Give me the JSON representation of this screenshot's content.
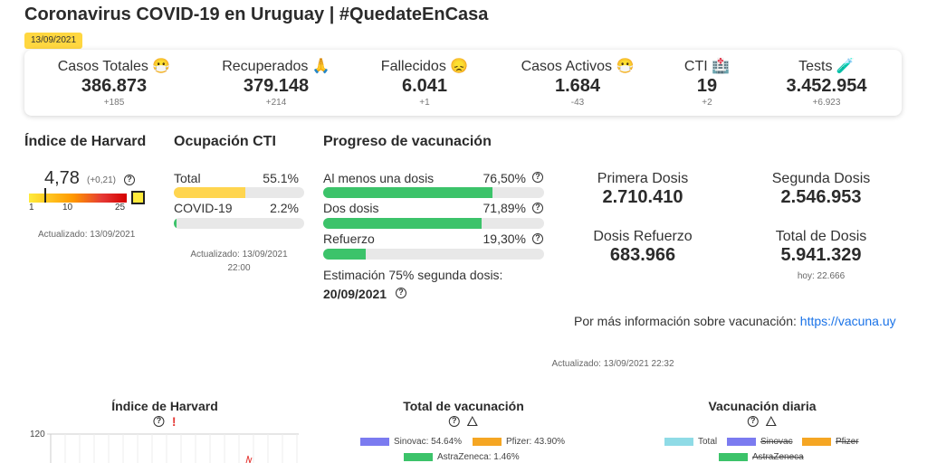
{
  "header": {
    "title": "Coronavirus COVID-19 en Uruguay | #QuedateEnCasa",
    "date": "13/09/2021"
  },
  "stats": [
    {
      "label": "Casos Totales 😷",
      "value": "386.873",
      "delta": "+185"
    },
    {
      "label": "Recuperados 🙏",
      "value": "379.148",
      "delta": "+214"
    },
    {
      "label": "Fallecidos 😞",
      "value": "6.041",
      "delta": "+1"
    },
    {
      "label": "Casos Activos 😷",
      "value": "1.684",
      "delta": "-43"
    },
    {
      "label": "CTI 🏥",
      "value": "19",
      "delta": "+2"
    },
    {
      "label": "Tests 🧪",
      "value": "3.452.954",
      "delta": "+6.923"
    }
  ],
  "harvard": {
    "title": "Índice de Harvard",
    "value": "4,78",
    "delta": "(+0,21)",
    "level": 4.78,
    "scale_labels": [
      "1",
      "10",
      "25"
    ],
    "updated": "Actualizado: 13/09/2021"
  },
  "cti": {
    "title": "Ocupación CTI",
    "rows": [
      {
        "label": "Total",
        "pct": "55.1%",
        "fill": 0.551,
        "color": "#ffd54f"
      },
      {
        "label": "COVID-19",
        "pct": "2.2%",
        "fill": 0.022,
        "color": "#3cc36a"
      }
    ],
    "updated_line1": "Actualizado: 13/09/2021",
    "updated_line2": "22:00"
  },
  "vaccination": {
    "title": "Progreso de vacunación",
    "rows": [
      {
        "label": "Al menos una dosis",
        "pct": "76,50%",
        "fill": 0.765
      },
      {
        "label": "Dos dosis",
        "pct": "71,89%",
        "fill": 0.7189
      },
      {
        "label": "Refuerzo",
        "pct": "19,30%",
        "fill": 0.193
      }
    ],
    "bar_color": "#3cc36a",
    "estimate_label": "Estimación 75% segunda dosis:",
    "estimate_date": "20/09/2021",
    "totals": [
      {
        "label": "Primera Dosis",
        "value": "2.710.410"
      },
      {
        "label": "Segunda Dosis",
        "value": "2.546.953"
      },
      {
        "label": "Dosis Refuerzo",
        "value": "683.966"
      },
      {
        "label": "Total de Dosis",
        "value": "5.941.329"
      }
    ],
    "today": "hoy: 22.666",
    "info_text": "Por más información sobre vacunación:",
    "info_link": "https://vacuna.uy",
    "updated": "Actualizado: 13/09/2021 22:32"
  },
  "charts": {
    "harvard": {
      "title": "Índice de Harvard",
      "y_top_label": "120"
    },
    "total_vac": {
      "title": "Total de vacunación",
      "legend": [
        {
          "label": "Sinovac: 54.64%",
          "color": "#7b7bf0"
        },
        {
          "label": "Pfizer: 43.90%",
          "color": "#f5a623"
        },
        {
          "label": "AstraZeneca: 1.46%",
          "color": "#3cc36a"
        }
      ]
    },
    "daily_vac": {
      "title": "Vacunación diaria",
      "legend": [
        {
          "label": "Total",
          "color": "#8fdbe6",
          "struck": false
        },
        {
          "label": "Sinovac",
          "color": "#7b7bf0",
          "struck": true
        },
        {
          "label": "Pfizer",
          "color": "#f5a623",
          "struck": true
        },
        {
          "label": "AstraZeneca",
          "color": "#3cc36a",
          "struck": true
        }
      ]
    }
  }
}
